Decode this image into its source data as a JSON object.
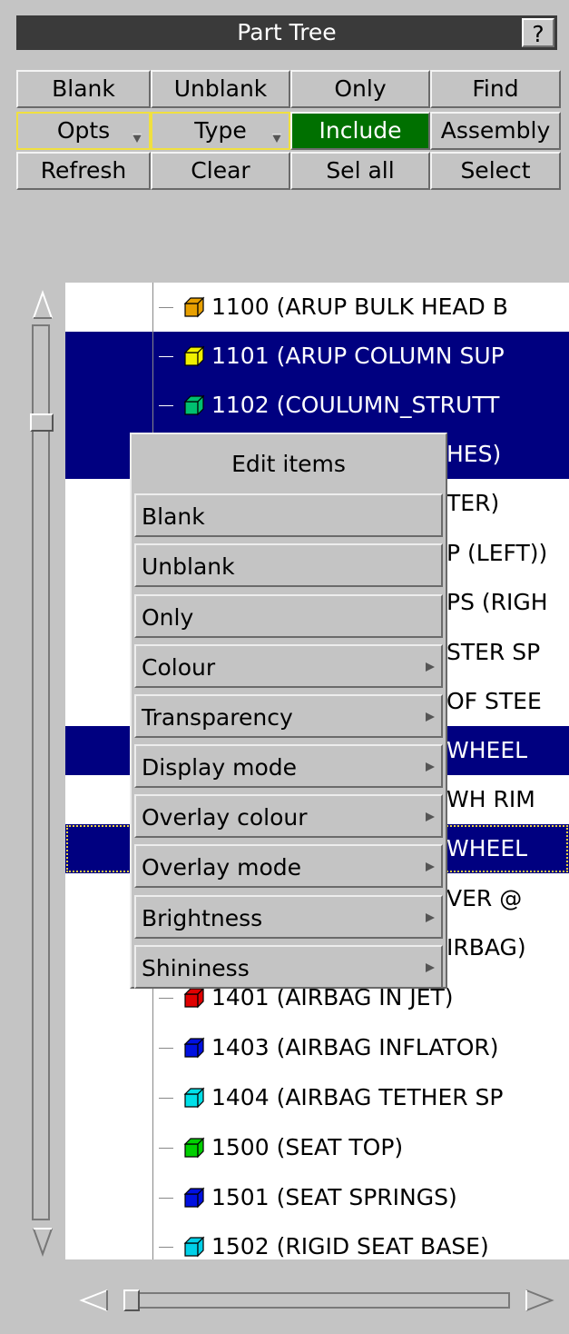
{
  "window": {
    "title": "Part Tree",
    "help_label": "?"
  },
  "buttons": {
    "blank": "Blank",
    "unblank": "Unblank",
    "only": "Only",
    "find": "Find",
    "opts": "Opts",
    "type": "Type",
    "include": "Include",
    "assembly": "Assembly",
    "refresh": "Refresh",
    "clear": "Clear",
    "sel_all": "Sel all",
    "select": "Select"
  },
  "colors": {
    "selection": "#000080",
    "include_active": "#007000",
    "option_border": "#f0e040"
  },
  "tree": {
    "rows": [
      {
        "label": "1100 (ARUP BULK HEAD B",
        "cube": "#e8a000",
        "selected": false
      },
      {
        "label": "1101 (ARUP COLUMN SUP",
        "cube": "#f0f000",
        "selected": true
      },
      {
        "label": "1102 (COULUMN_STRUTT",
        "cube": "#00c070",
        "selected": true
      },
      {
        "label": "HES)",
        "cube": "",
        "selected": true
      },
      {
        "label": "TER)",
        "cube": "",
        "selected": false
      },
      {
        "label": "P (LEFT))",
        "cube": "",
        "selected": false
      },
      {
        "label": "PS (RIGH",
        "cube": "",
        "selected": false
      },
      {
        "label": "STER SP",
        "cube": "",
        "selected": false
      },
      {
        "label": "OF STEE",
        "cube": "",
        "selected": false
      },
      {
        "label": "WHEEL",
        "cube": "",
        "selected": true
      },
      {
        "label": "WH RIM",
        "cube": "",
        "selected": false
      },
      {
        "label": "WHEEL",
        "cube": "",
        "selected": true
      },
      {
        "label": "VER @",
        "cube": "",
        "selected": false
      },
      {
        "label": "IRBAG)",
        "cube": "",
        "selected": false
      },
      {
        "label": "1401 (AIRBAG IN JET)",
        "cube": "#e00000",
        "selected": false
      },
      {
        "label": "1403 (AIRBAG INFLATOR)",
        "cube": "#0010e0",
        "selected": false
      },
      {
        "label": "1404 (AIRBAG TETHER SP",
        "cube": "#00e0e8",
        "selected": false
      },
      {
        "label": "1500 (SEAT TOP)",
        "cube": "#00d000",
        "selected": false
      },
      {
        "label": "1501 (SEAT SPRINGS)",
        "cube": "#0010e0",
        "selected": false
      },
      {
        "label": "1502 (RIGID SEAT BASE)",
        "cube": "#00d0e8",
        "selected": false
      }
    ]
  },
  "context_menu": {
    "title": "Edit items",
    "items": [
      {
        "label": "Blank",
        "submenu": false
      },
      {
        "label": "Unblank",
        "submenu": false
      },
      {
        "label": "Only",
        "submenu": false
      },
      {
        "label": "Colour",
        "submenu": true
      },
      {
        "label": "Transparency",
        "submenu": true
      },
      {
        "label": "Display mode",
        "submenu": true
      },
      {
        "label": "Overlay colour",
        "submenu": true
      },
      {
        "label": "Overlay mode",
        "submenu": true
      },
      {
        "label": "Brightness",
        "submenu": true
      },
      {
        "label": "Shininess",
        "submenu": true
      }
    ]
  }
}
